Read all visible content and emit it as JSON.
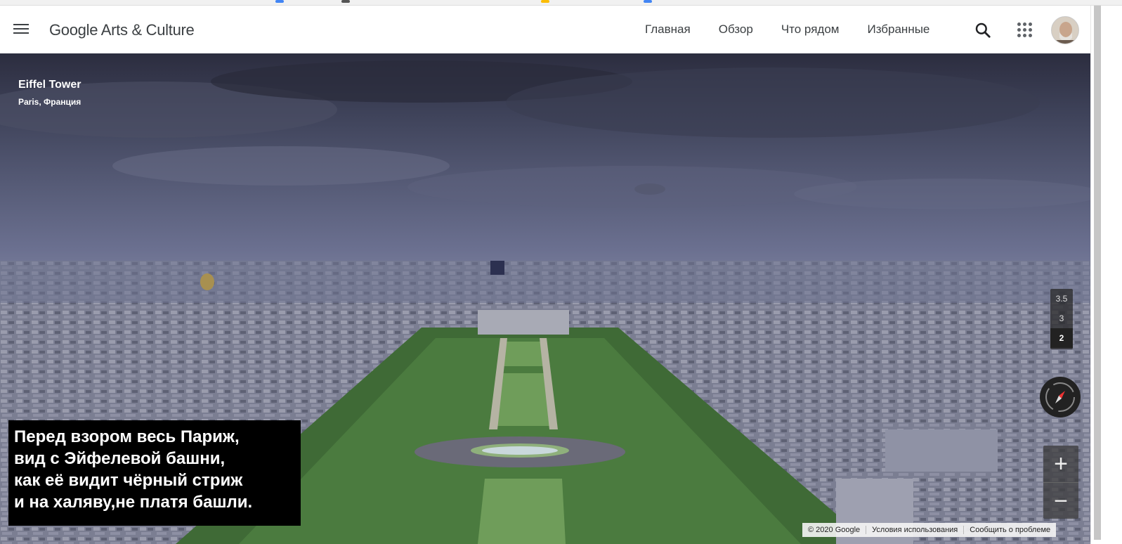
{
  "header": {
    "logo_text": "Google Arts & Culture",
    "nav": [
      "Главная",
      "Обзор",
      "Что рядом",
      "Избранные"
    ]
  },
  "place": {
    "title": "Eiffel Tower",
    "subtitle": "Paris, Франция"
  },
  "caption": {
    "lines": [
      "Перед взором весь Париж,",
      "вид с Эйфелевой башни,",
      "как её видит чёрный стриж",
      "и на халяву,не платя башли."
    ]
  },
  "floors": [
    "3.5",
    "3",
    "2"
  ],
  "active_floor": "2",
  "zoom": {
    "in": "+",
    "out": "−"
  },
  "footer": {
    "copyright": "© 2020 Google",
    "terms": "Условия использования",
    "report": "Сообщить о проблеме"
  },
  "colors": {
    "caption_bg": "#000000",
    "caption_text": "#ffffff",
    "nav_text": "#3c4043"
  }
}
